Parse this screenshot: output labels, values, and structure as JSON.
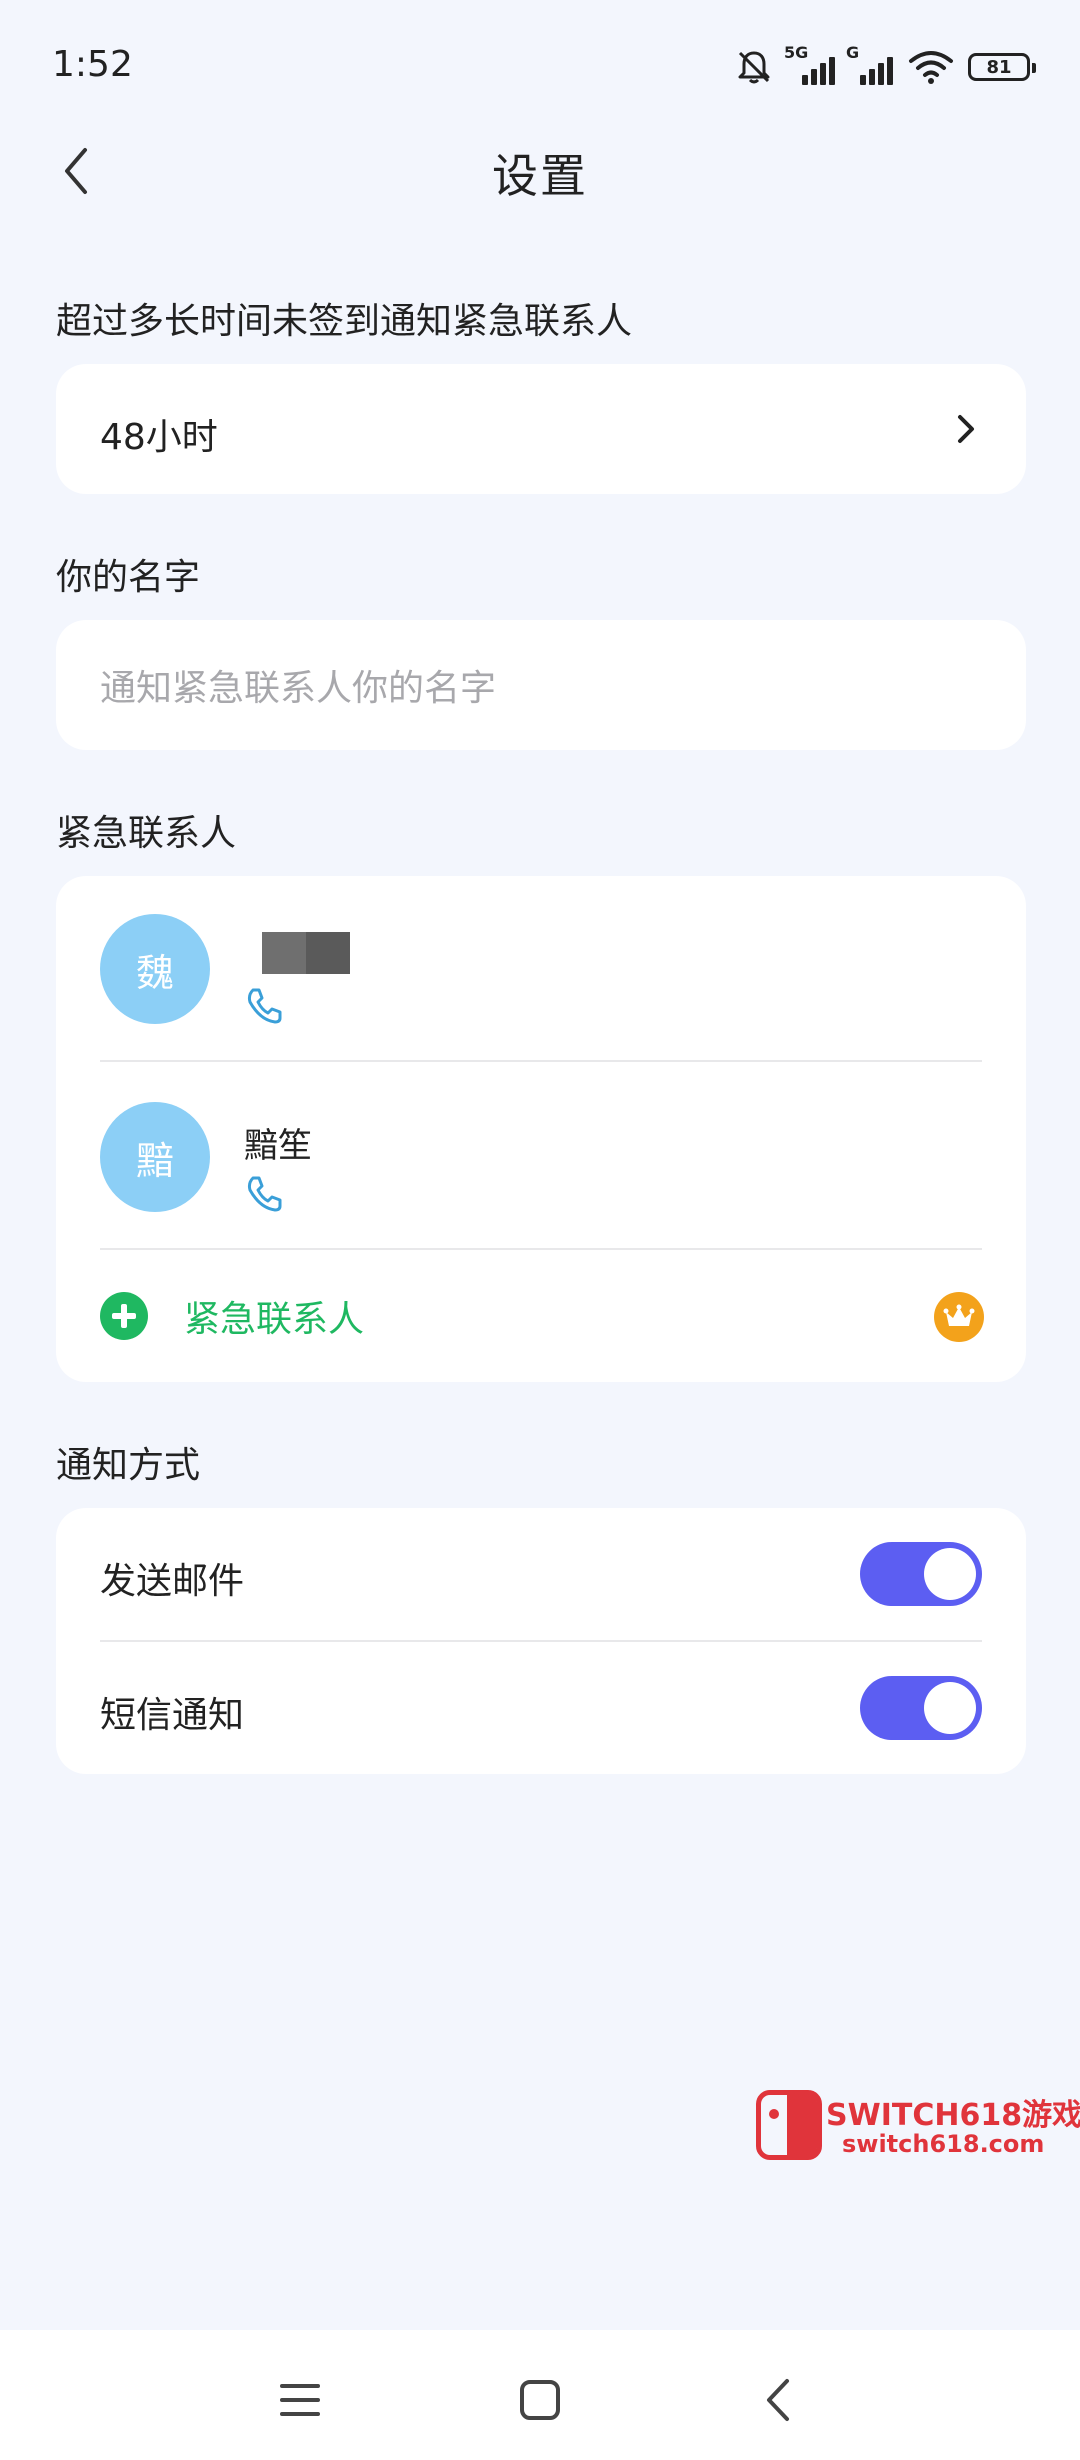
{
  "status_bar": {
    "time": "1:52",
    "network_1": "5G",
    "network_2": "G",
    "battery": "81"
  },
  "header": {
    "title": "设置"
  },
  "checkin_section": {
    "label": "超过多长时间未签到通知紧急联系人",
    "value": "48小时"
  },
  "name_section": {
    "label": "你的名字",
    "placeholder": "通知紧急联系人你的名字"
  },
  "contacts_section": {
    "label": "紧急联系人",
    "contacts": [
      {
        "avatar": "魏",
        "name": "",
        "phone_icon": "phone-icon"
      },
      {
        "avatar": "黯",
        "name": "黯笙",
        "phone_icon": "phone-icon"
      }
    ],
    "add_label": "紧急联系人",
    "add_icon": "plus-circle-icon",
    "premium_icon": "crown-icon"
  },
  "notify_section": {
    "label": "通知方式",
    "options": [
      {
        "label": "发送邮件",
        "enabled": true
      },
      {
        "label": "短信通知",
        "enabled": true
      }
    ]
  },
  "watermark": {
    "title": "SWITCH618游戏",
    "url": "switch618.com"
  },
  "colors": {
    "background": "#f3f6fd",
    "accent_green": "#1fb861",
    "toggle_on": "#5c5ef2",
    "avatar": "#8ccff6",
    "crown": "#f3a21b"
  }
}
